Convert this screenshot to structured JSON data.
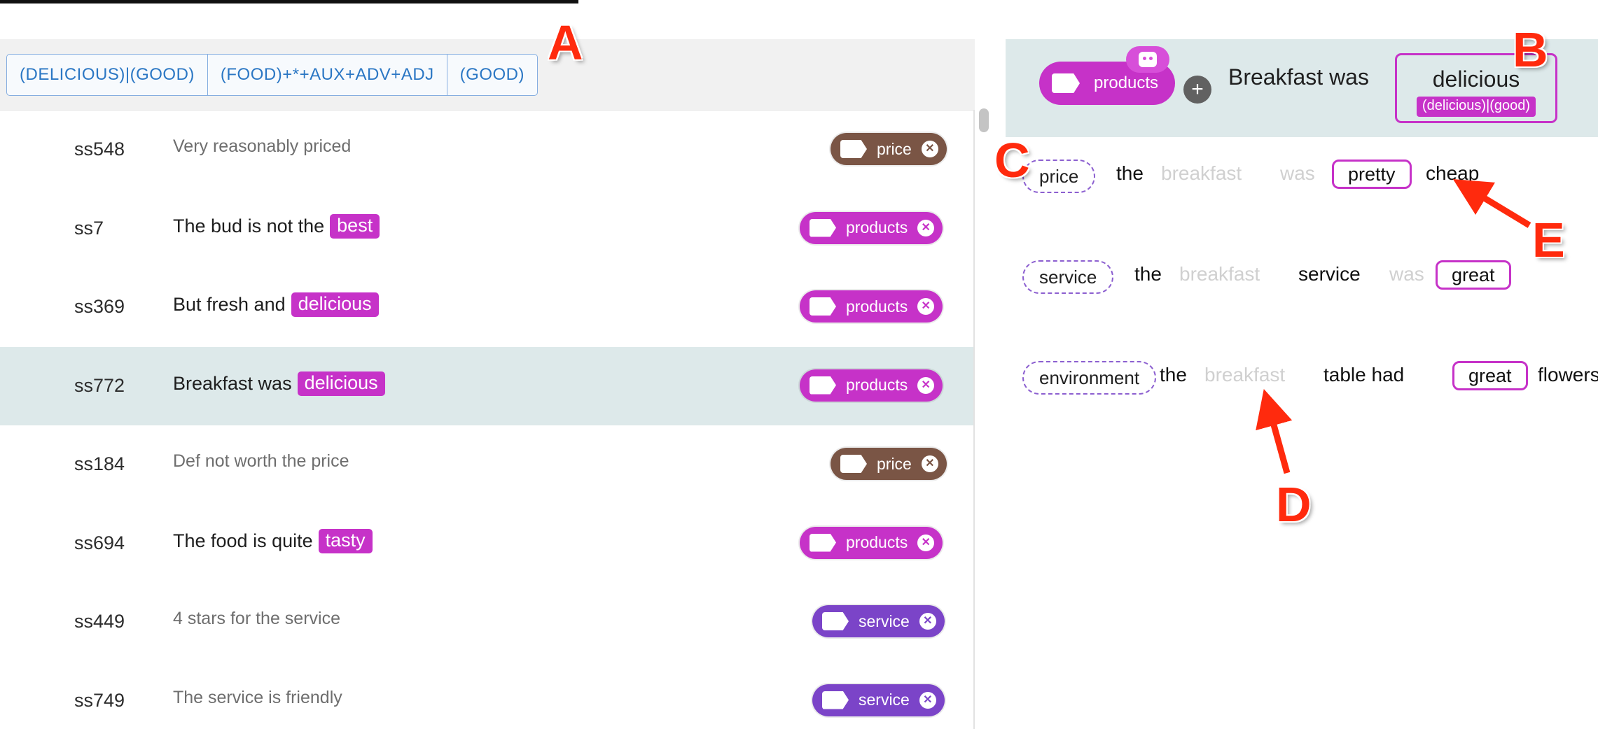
{
  "filter_bar": {
    "chips": [
      "(DELICIOUS)|(GOOD)",
      "(FOOD)+*+AUX+ADV+ADJ",
      "(GOOD)"
    ]
  },
  "rows": [
    {
      "id": "ss548",
      "text_before": "Very reasonably priced",
      "highlight": "",
      "tag": "price",
      "tag_color": "#7a5545",
      "style": "muted",
      "selected": false
    },
    {
      "id": "ss7",
      "text_before": "The bud is not the",
      "highlight": "best",
      "tag": "products",
      "tag_color": "#c632c8",
      "style": "dark",
      "selected": false
    },
    {
      "id": "ss369",
      "text_before": "But fresh and",
      "highlight": "delicious",
      "tag": "products",
      "tag_color": "#c632c8",
      "style": "dark",
      "selected": false
    },
    {
      "id": "ss772",
      "text_before": "Breakfast was",
      "highlight": "delicious",
      "tag": "products",
      "tag_color": "#c632c8",
      "style": "dark",
      "selected": true
    },
    {
      "id": "ss184",
      "text_before": "Def not worth the price",
      "highlight": "",
      "tag": "price",
      "tag_color": "#7a5545",
      "style": "muted",
      "selected": false
    },
    {
      "id": "ss694",
      "text_before": "The food is quite",
      "highlight": "tasty",
      "tag": "products",
      "tag_color": "#c632c8",
      "style": "dark",
      "selected": false
    },
    {
      "id": "ss449",
      "text_before": "4 stars for the service",
      "highlight": "",
      "tag": "service",
      "tag_color": "#7b44c8",
      "style": "muted",
      "selected": false
    },
    {
      "id": "ss749",
      "text_before": "The service is friendly",
      "highlight": "",
      "tag": "service",
      "tag_color": "#7b44c8",
      "style": "muted",
      "selected": false
    }
  ],
  "right_header": {
    "tag_label": "products",
    "plus_symbol": "+",
    "sentence": "Breakfast was",
    "target_word": "delicious",
    "target_pattern": "(delicious)|(good)"
  },
  "examples": {
    "price": {
      "category": "price",
      "w1": "the",
      "w2": "breakfast",
      "w3": "was",
      "box": "pretty",
      "w4": "cheap"
    },
    "service": {
      "category": "service",
      "w1": "the",
      "w2": "breakfast",
      "w3": "service",
      "w4": "was",
      "box": "great"
    },
    "environment": {
      "category": "environment",
      "w1": "the",
      "w2": "breakfast",
      "w3": "table had",
      "box": "great",
      "w4": "flowers"
    }
  },
  "callouts": {
    "a": "A",
    "b": "B",
    "c": "C",
    "d": "D",
    "e": "E"
  },
  "colors": {
    "accent_magenta": "#c632c8",
    "price_brown": "#7a5545",
    "service_purple": "#7b44c8",
    "filter_blue": "#2b77c4",
    "selected_row": "#dde9ea",
    "callout_red": "#ff2a0d"
  },
  "icons": {
    "tag": "label-tag-icon",
    "remove": "close-circle-icon",
    "robot": "robot-icon",
    "add": "plus-icon"
  }
}
